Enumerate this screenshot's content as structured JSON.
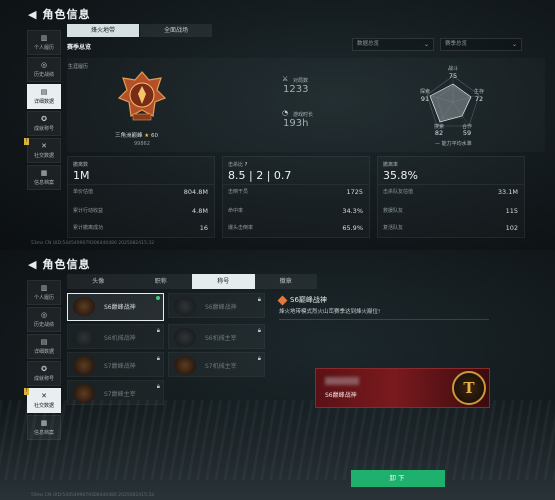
{
  "screen1": {
    "title": "角色信息",
    "sidebar": [
      {
        "label": "个人履历",
        "icon": "bar-chart-icon"
      },
      {
        "label": "历史战绩",
        "icon": "target-icon"
      },
      {
        "label": "详细数据",
        "icon": "data-icon"
      },
      {
        "label": "成就称号",
        "icon": "medal-icon"
      },
      {
        "label": "社交数据",
        "icon": "social-icon"
      },
      {
        "label": "信息档案",
        "icon": "file-icon"
      }
    ],
    "tabs": [
      "烽火地带",
      "全面战场"
    ],
    "active_tab": 0,
    "section_title": "赛季总览",
    "dropdown_season": "数据总览",
    "dropdown_mode": "赛季总览",
    "summary": {
      "subtitle": "生涯履历",
      "medal_name": "三角洲巅峰",
      "medal_stars": "60",
      "medal_sub": "99862",
      "stat1_label": "对局数",
      "stat1_value": "1233",
      "stat2_label": "游戏时长",
      "stat2_value": "193h"
    },
    "radar": {
      "labels": [
        "战斗",
        "生存",
        "合作",
        "搜索",
        "探索"
      ],
      "values": [
        "75",
        "72",
        "59",
        "82",
        "91"
      ],
      "legend": "能力平均水准"
    },
    "cards": [
      {
        "label": "撤离数",
        "value": "1M",
        "rows": [
          {
            "k": "单价估值",
            "v": "804.8M"
          },
          {
            "k": "累计行动收益",
            "v": "4.8M"
          },
          {
            "k": "累计撤离成功",
            "v": "16"
          }
        ]
      },
      {
        "label": "击杀比",
        "value": "8.5 | 2 | 0.7",
        "rows": [
          {
            "k": "击倒干员",
            "v": "1725"
          },
          {
            "k": "命中率",
            "v": "34.3%"
          },
          {
            "k": "爆头击倒率",
            "v": "65.9%"
          }
        ]
      },
      {
        "label": "撤离率",
        "value": "35.8%",
        "rows": [
          {
            "k": "击杀队友估值",
            "v": "33.1M"
          },
          {
            "k": "救援队友",
            "v": "115"
          },
          {
            "k": "复活队友",
            "v": "102"
          }
        ]
      }
    ],
    "footer": "53ms  CN UID:5445499079306440480 2025082415:32"
  },
  "screen2": {
    "title": "角色信息",
    "sidebar": [
      {
        "label": "个人履历",
        "icon": "bar-chart-icon"
      },
      {
        "label": "历史战绩",
        "icon": "target-icon"
      },
      {
        "label": "详细数据",
        "icon": "data-icon"
      },
      {
        "label": "成就称号",
        "icon": "medal-icon"
      },
      {
        "label": "社交数据",
        "icon": "social-icon"
      },
      {
        "label": "信息档案",
        "icon": "file-icon"
      }
    ],
    "tabs": [
      "头像",
      "职称",
      "称号",
      "徽章"
    ],
    "active_tab": 2,
    "titles": [
      {
        "name": "S6巅峰战神",
        "locked": false,
        "selected": true
      },
      {
        "name": "S6巅峰战神",
        "locked": true
      },
      {
        "name": "S6机械战神",
        "locked": true
      },
      {
        "name": "S6机械主宰",
        "locked": true
      },
      {
        "name": "S7巅峰战神",
        "locked": true
      },
      {
        "name": "S7机械主宰",
        "locked": true
      },
      {
        "name": "S7巅峰主宰",
        "locked": true
      }
    ],
    "detail": {
      "name": "S6巅峰战神",
      "desc": "烽火地带模式烈火山峦赛季达到烽火巅位!"
    },
    "banner_name": "S6巅峰战神",
    "equip_button": "卸下",
    "footer": "59ms  CN UID:5445499079306440480 2025082415:32"
  }
}
